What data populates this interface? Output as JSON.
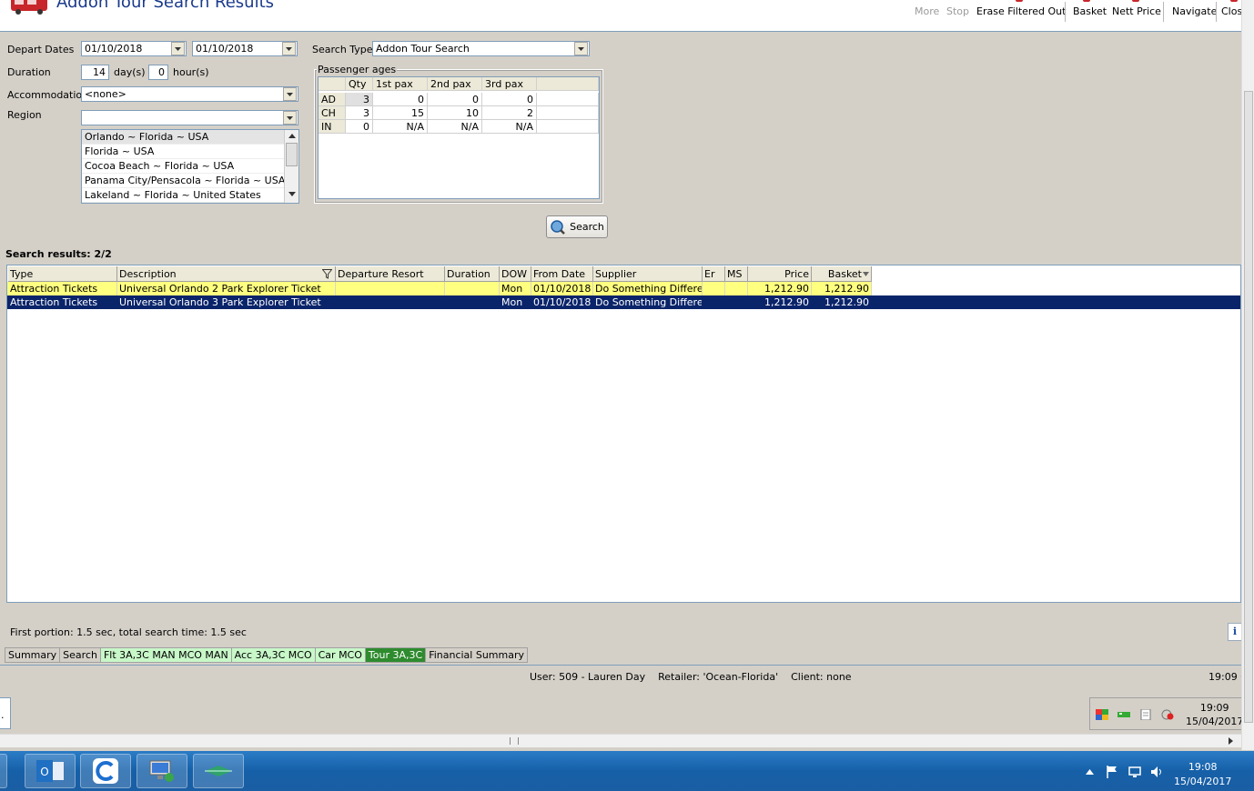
{
  "header": {
    "title": "Addon Tour Search Results",
    "toolbar": {
      "more": "More",
      "stop": "Stop",
      "erase_filtered_out": "Erase Filtered Out",
      "basket": "Basket",
      "nett_price": "Nett Price",
      "navigate": "Navigate",
      "close": "Close"
    }
  },
  "form": {
    "depart_dates_label": "Depart Dates",
    "depart_from": "01/10/2018",
    "depart_to": "01/10/2018",
    "duration_label": "Duration",
    "duration_days": "14",
    "days_unit": "day(s)",
    "duration_hours": "0",
    "hours_unit": "hour(s)",
    "accommodation_label": "Accommodation",
    "accommodation_value": "<none>",
    "region_label": "Region",
    "region_value": "",
    "region_items": [
      "Orlando ~ Florida ~ USA",
      "Florida ~ USA",
      "Cocoa Beach ~ Florida ~ USA",
      "Panama City/Pensacola ~  Florida  ~ USA",
      "Lakeland ~ Florida ~ United States"
    ],
    "search_type_label": "Search Type",
    "search_type_value": "Addon Tour Search",
    "passenger_ages_label": "Passenger ages",
    "pax_headers": [
      "Qty",
      "1st pax",
      "2nd pax",
      "3rd pax"
    ],
    "pax_rows": [
      {
        "type": "AD",
        "qty": "3",
        "p1": "0",
        "p2": "0",
        "p3": "0"
      },
      {
        "type": "CH",
        "qty": "3",
        "p1": "15",
        "p2": "10",
        "p3": "2"
      },
      {
        "type": "IN",
        "qty": "0",
        "p1": "N/A",
        "p2": "N/A",
        "p3": "N/A"
      }
    ],
    "search_button": "Search"
  },
  "results": {
    "label": "Search results: 2/2",
    "columns": [
      "Type",
      "Description",
      "Departure Resort",
      "Duration",
      "DOW",
      "From Date",
      "Supplier",
      "Er",
      "MS",
      "Price",
      "Basket"
    ],
    "rows": [
      {
        "type": "Attraction Tickets",
        "description": "Universal Orlando 2 Park Explorer Ticket",
        "resort": "",
        "duration": "",
        "dow": "Mon",
        "from_date": "01/10/2018",
        "supplier": "Do Something Different",
        "er": "",
        "ms": "",
        "price": "1,212.90",
        "basket": "1,212.90"
      },
      {
        "type": "Attraction Tickets",
        "description": "Universal Orlando 3 Park Explorer Ticket",
        "resort": "",
        "duration": "",
        "dow": "Mon",
        "from_date": "01/10/2018",
        "supplier": "Do Something Different",
        "er": "",
        "ms": "",
        "price": "1,212.90",
        "basket": "1,212.90"
      }
    ]
  },
  "footer": {
    "timing": "First portion: 1.5 sec, total search time: 1.5 sec",
    "info": "i",
    "tabs": [
      "Summary",
      "Search",
      "Flt 3A,3C MAN MCO MAN",
      "Acc 3A,3C MCO",
      "Car MCO",
      "Tour 3A,3C",
      "Financial Summary"
    ],
    "status_user": "User: 509 - Lauren Day    Retailer: 'Ocean-Florida'    Client: none",
    "status_time": "19:09 G",
    "left_field": ".",
    "tray_time": "19:09",
    "tray_date": "15/04/2017"
  },
  "taskbar": {
    "clock_time": "19:08",
    "clock_date": "15/04/2017"
  },
  "colors": {
    "selected_row": "#0a246a",
    "highlight_row": "#ffff80",
    "active_tab": "#2e8b2e",
    "green_tab": "#c8f7c8",
    "taskbar": "#1660a8"
  },
  "icons": [
    "bus-icon",
    "search-magnifier-icon",
    "filter-icon",
    "sort-desc-icon",
    "info-icon",
    "outlook-icon",
    "app-c-icon",
    "remote-desktop-icon",
    "folder-icon",
    "flag-icon",
    "network-icon",
    "speaker-icon"
  ]
}
